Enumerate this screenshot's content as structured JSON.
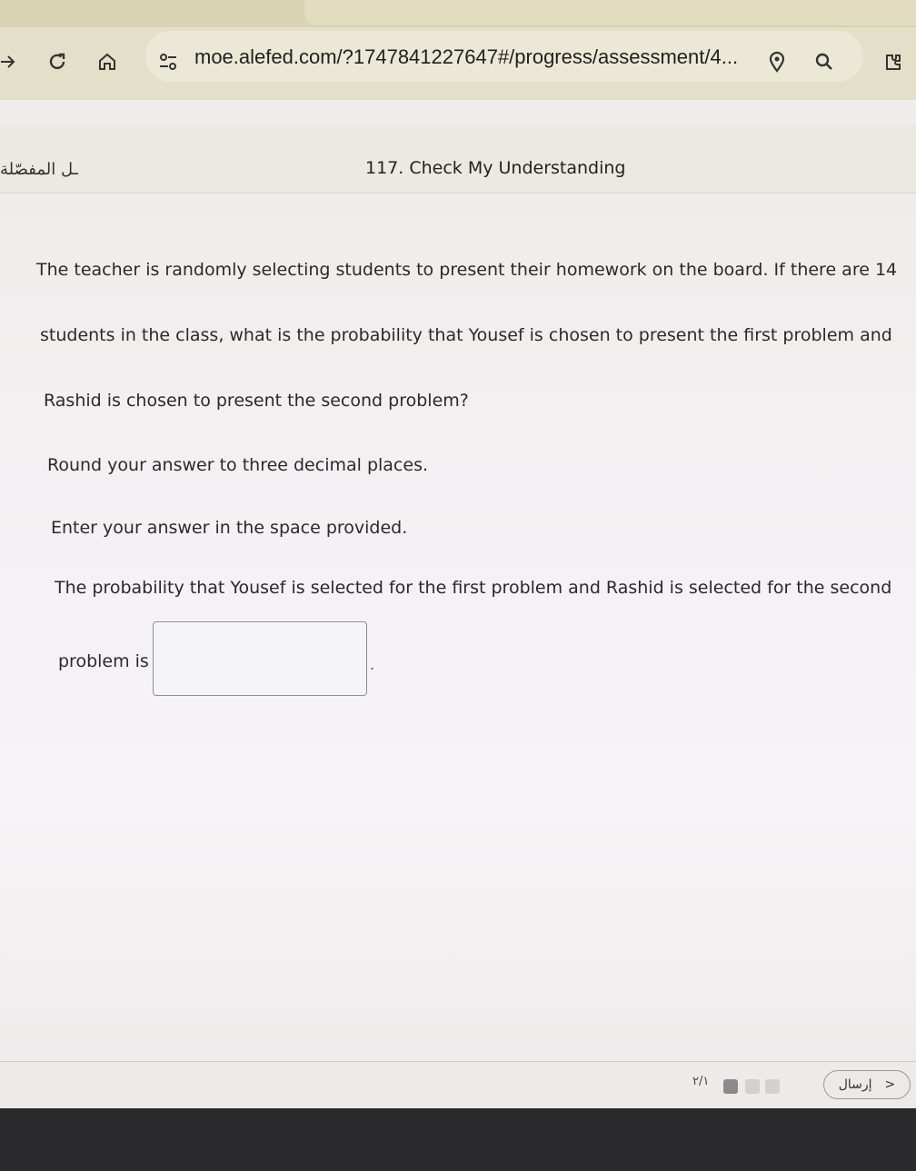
{
  "browser": {
    "url": "moe.alefed.com/?1747841227647#/progress/assessment/4..."
  },
  "header": {
    "arabic_label": "ـل المفصّلة",
    "title": "117. Check My Understanding"
  },
  "question": {
    "line1": "The teacher is randomly selecting students to present their homework on the board. If there are 14",
    "line2": "students in the class, what is the probability that Yousef is chosen to present the first problem and",
    "line3": "Rashid is chosen to present the second problem?",
    "instruction1": "Round your answer to three decimal places.",
    "instruction2": "Enter your answer in the space provided.",
    "prompt1": "The probability that Yousef is selected for the first problem and Rashid is selected for the second",
    "prompt2": "problem is",
    "answer_value": "",
    "period": "."
  },
  "footer": {
    "page_count": "٢/١",
    "submit_label": "إرسال",
    "submit_arrow": ">"
  },
  "colors": {
    "dot_active": "#8a8a8a",
    "dot_inactive": "#d2d0d0"
  }
}
